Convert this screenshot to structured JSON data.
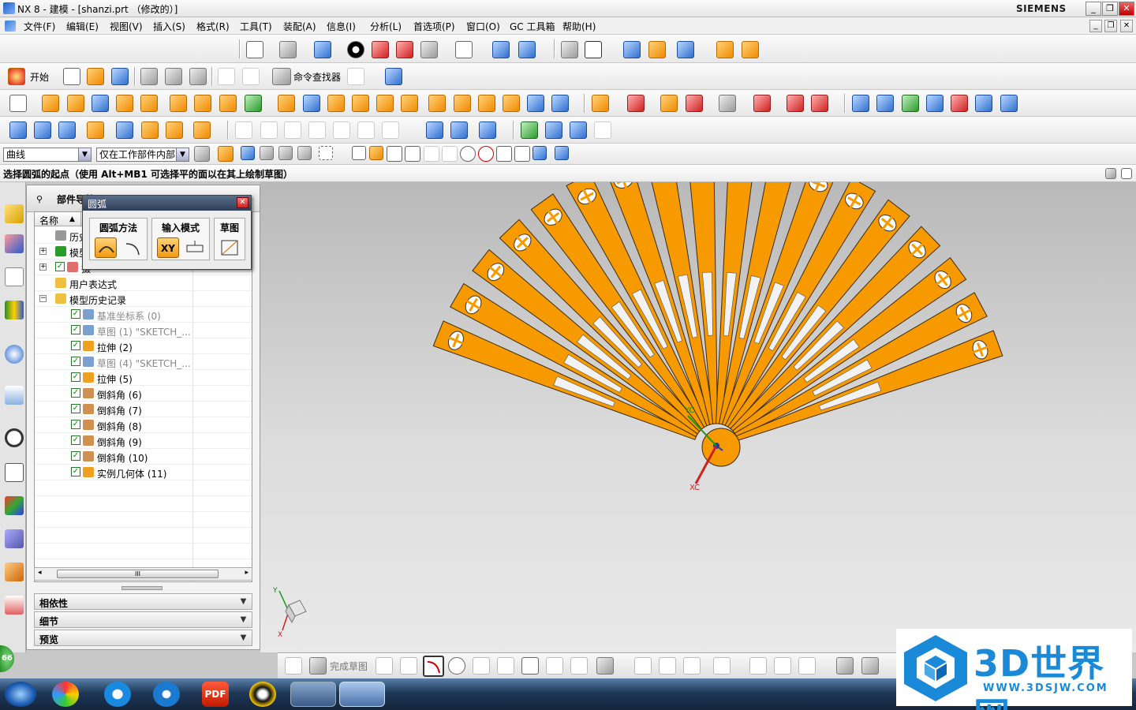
{
  "window": {
    "title": "NX 8 - 建模 - [shanzi.prt （修改的）]",
    "brand": "SIEMENS",
    "controls": [
      "_",
      "❐",
      "✕"
    ]
  },
  "menubar": {
    "items": [
      "文件(F)",
      "编辑(E)",
      "视图(V)",
      "插入(S)",
      "格式(R)",
      "工具(T)",
      "装配(A)",
      "信息(I)",
      "分析(L)",
      "首选项(P)",
      "窗口(O)",
      "GC 工具箱",
      "帮助(H)"
    ]
  },
  "standard_toolbar": {
    "start_label": "开始",
    "command_finder_label": "命令查找器"
  },
  "selection_bar": {
    "filter_value": "曲线",
    "scope_value": "仅在工作部件内部"
  },
  "cue_line": "选择圆弧的起点（使用 Alt+MB1 可选择平的面以在其上绘制草图）",
  "navigator": {
    "title": "部件导航器",
    "column_name": "名称",
    "rows": [
      {
        "label": "历史",
        "state": "normal"
      },
      {
        "label": "模型",
        "state": "normal"
      },
      {
        "label": "摄",
        "state": "normal"
      },
      {
        "label": "用户表达式",
        "state": "normal"
      },
      {
        "label": "模型历史记录",
        "state": "normal"
      },
      {
        "label": "基准坐标系 (0)",
        "state": "grey"
      },
      {
        "label": "草图 (1) \"SKETCH_...",
        "state": "grey"
      },
      {
        "label": "拉伸 (2)",
        "state": "normal"
      },
      {
        "label": "草图 (4) \"SKETCH_...",
        "state": "grey"
      },
      {
        "label": "拉伸 (5)",
        "state": "normal"
      },
      {
        "label": "倒斜角 (6)",
        "state": "normal"
      },
      {
        "label": "倒斜角 (7)",
        "state": "normal"
      },
      {
        "label": "倒斜角 (8)",
        "state": "normal"
      },
      {
        "label": "倒斜角 (9)",
        "state": "normal"
      },
      {
        "label": "倒斜角 (10)",
        "state": "normal"
      },
      {
        "label": "实例几何体 (11)",
        "state": "normal"
      }
    ],
    "scroll_thumb": "III",
    "panels": [
      "相依性",
      "细节",
      "预览"
    ]
  },
  "arc_dialog": {
    "title": "圆弧",
    "groups": [
      {
        "label": "圆弧方法"
      },
      {
        "label": "输入模式",
        "button": "XY"
      },
      {
        "label": "草图"
      }
    ]
  },
  "viewport": {
    "axis_xc": "XC",
    "axis_yc": "YC",
    "triad_x": "X",
    "triad_y": "Y",
    "fan_color": "#F79A00",
    "background_top": "#b9b9b9",
    "background_bottom": "#e9e9e9"
  },
  "sketch_toolbar": {
    "finish_label": "完成草图"
  },
  "status_badge": "66",
  "watermark": {
    "text": "3D世界网",
    "url": "WWW.3DSJW.COM"
  },
  "taskbar": {
    "items": [
      "start",
      "pinwheel-app",
      "media-player",
      "sogou",
      "pdf",
      "qq",
      "file-explorer",
      "nx"
    ],
    "pdf_label": "PDF"
  }
}
